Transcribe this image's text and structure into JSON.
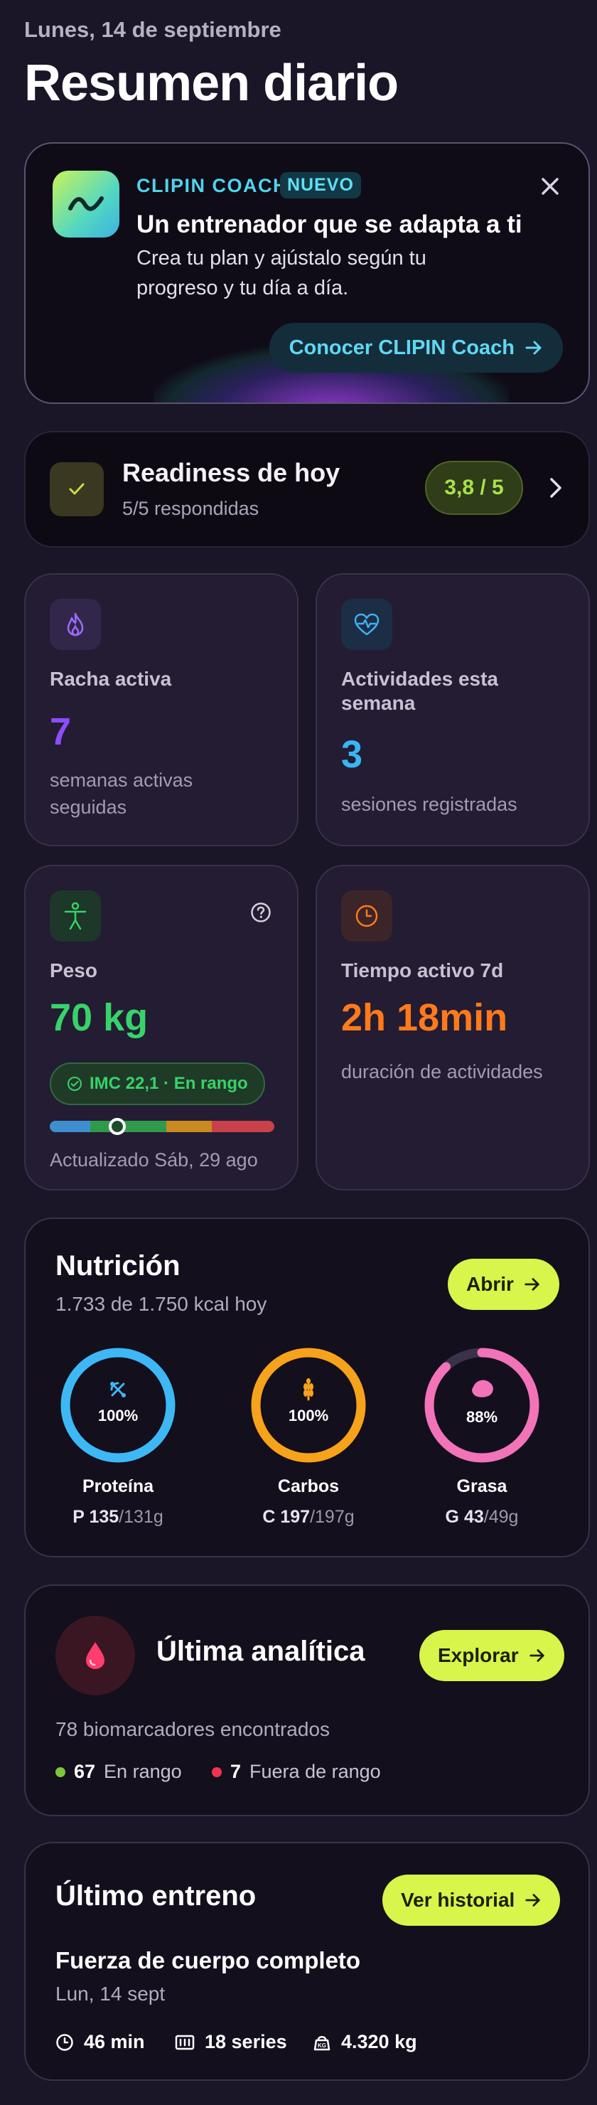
{
  "header": {
    "date": "Lunes, 14 de septiembre",
    "title": "Resumen diario"
  },
  "coach": {
    "brand": "CLIPIN COACH",
    "badge": "NUEVO",
    "headline": "Un entrenador que se adapta a ti",
    "description": "Crea tu plan y ajústalo según tu progreso y tu día a día.",
    "cta": "Conocer CLIPIN Coach"
  },
  "readiness": {
    "title": "Readiness de hoy",
    "subtitle": "5/5 respondidas",
    "score": "3,8 / 5"
  },
  "streak": {
    "label": "Racha activa",
    "value": "7",
    "desc": "semanas activas seguidas",
    "color": "#8b4dff"
  },
  "activities": {
    "label": "Actividades esta semana",
    "value": "3",
    "desc": "sesiones registradas",
    "color": "#38b6f4"
  },
  "weight": {
    "label": "Peso",
    "value": "70 kg",
    "imc": "IMC 22,1 · En rango",
    "updated": "Actualizado Sáb, 29 ago",
    "color": "#37d36a",
    "bmi_position": 0.3
  },
  "active_time": {
    "label": "Tiempo activo 7d",
    "value": "2h 18min",
    "desc": "duración de actividades",
    "color": "#ff7a1a"
  },
  "nutrition": {
    "title": "Nutrición",
    "subtitle": "1.733 de 1.750 kcal hoy",
    "button": "Abrir",
    "macros": [
      {
        "name": "Proteína",
        "percent_label": "100%",
        "progress": 1.0,
        "letter": "P",
        "amount": "135",
        "goal": "/131g",
        "color": "#3db8f5",
        "icon": "protein-icon"
      },
      {
        "name": "Carbos",
        "percent_label": "100%",
        "progress": 1.0,
        "letter": "C",
        "amount": "197",
        "goal": "/197g",
        "color": "#f7a21b",
        "icon": "wheat-icon"
      },
      {
        "name": "Grasa",
        "percent_label": "88%",
        "progress": 0.88,
        "letter": "G",
        "amount": "43",
        "goal": "/49g",
        "color": "#f273b8",
        "icon": "fat-icon"
      }
    ]
  },
  "analytics": {
    "title": "Última analítica",
    "button": "Explorar",
    "found": "78 biomarcadores encontrados",
    "in_range_count": "67",
    "in_range_label": "En rango",
    "out_range_count": "7",
    "out_range_label": "Fuera de rango"
  },
  "training": {
    "title": "Último entreno",
    "button": "Ver historial",
    "name": "Fuerza de cuerpo completo",
    "date": "Lun, 14 sept",
    "duration": "46 min",
    "series": "18 series",
    "volume": "4.320 kg"
  }
}
